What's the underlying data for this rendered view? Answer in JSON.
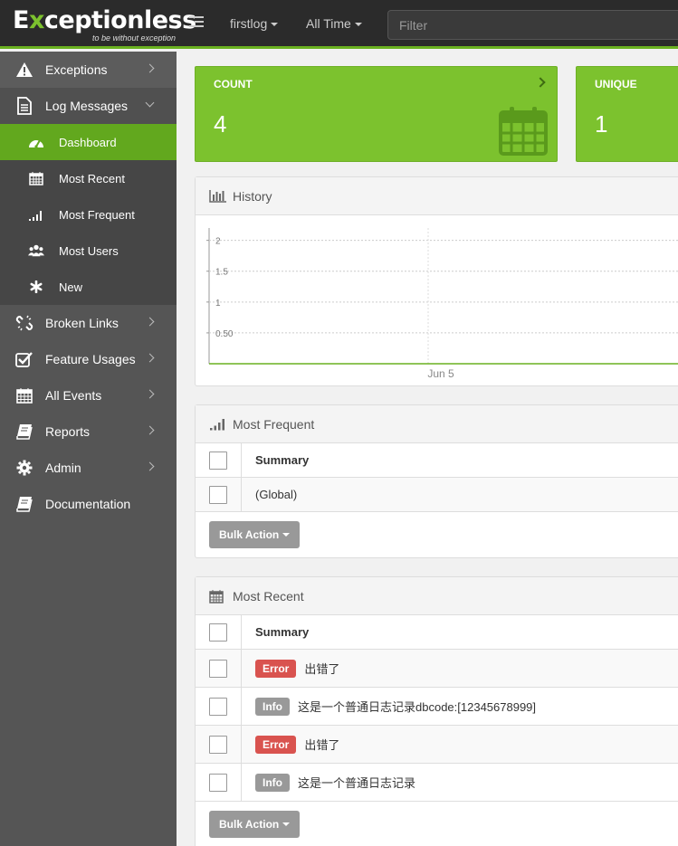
{
  "brand": {
    "name_prefix": "E",
    "name_rest": "ceptionless",
    "tagline": "to be without exception"
  },
  "navbar": {
    "project": "firstlog",
    "time_range": "All Time",
    "filter_placeholder": "Filter"
  },
  "sidebar": {
    "items": [
      {
        "label": "Exceptions",
        "icon": "warning-icon"
      },
      {
        "label": "Log Messages",
        "icon": "document-icon"
      },
      {
        "label": "Broken Links",
        "icon": "broken-link-icon"
      },
      {
        "label": "Feature Usages",
        "icon": "check-square-icon"
      },
      {
        "label": "All Events",
        "icon": "calendar-icon"
      },
      {
        "label": "Reports",
        "icon": "book-icon"
      },
      {
        "label": "Admin",
        "icon": "gear-icon"
      },
      {
        "label": "Documentation",
        "icon": "book-icon"
      }
    ],
    "sub_items": [
      {
        "label": "Dashboard",
        "icon": "dashboard-icon"
      },
      {
        "label": "Most Recent",
        "icon": "calendar-icon"
      },
      {
        "label": "Most Frequent",
        "icon": "signal-icon"
      },
      {
        "label": "Most Users",
        "icon": "users-icon"
      },
      {
        "label": "New",
        "icon": "asterisk-icon"
      }
    ]
  },
  "stats": {
    "count_label": "COUNT",
    "count_value": "4",
    "unique_label": "UNIQUE",
    "unique_value": "1"
  },
  "history": {
    "title": "History"
  },
  "chart_data": {
    "type": "line",
    "x_tick_labels": [
      "Jun 5"
    ],
    "y_tick_labels": [
      "2",
      "1.5",
      "1",
      "0.50"
    ],
    "y_ticks": [
      2,
      1.5,
      1,
      0.5
    ],
    "ylim": [
      0,
      2.2
    ],
    "grid": true,
    "series": []
  },
  "most_frequent": {
    "title": "Most Frequent",
    "header": "Summary",
    "rows": [
      {
        "summary": "(Global)"
      }
    ],
    "bulk_label": "Bulk Action"
  },
  "most_recent": {
    "title": "Most Recent",
    "header": "Summary",
    "rows": [
      {
        "level": "Error",
        "message": "出错了"
      },
      {
        "level": "Info",
        "message": "这是一个普通日志记录dbcode:[12345678999]"
      },
      {
        "level": "Error",
        "message": "出错了"
      },
      {
        "level": "Info",
        "message": "这是一个普通日志记录"
      }
    ],
    "bulk_label": "Bulk Action"
  },
  "colors": {
    "accent": "#7cc22e",
    "active": "#62a81e",
    "sidebar": "#555555",
    "error": "#d9534f",
    "info": "#999999"
  }
}
